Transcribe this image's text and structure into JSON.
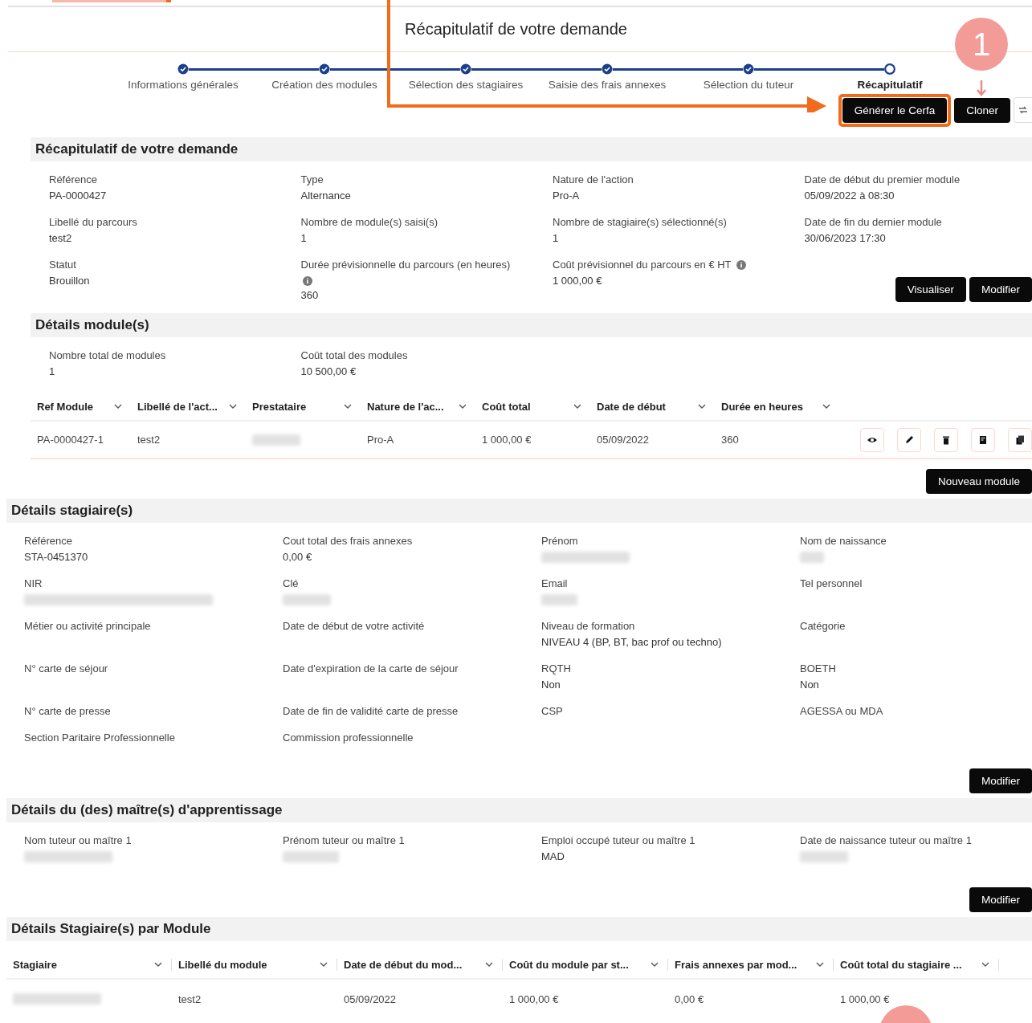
{
  "title": "Récapitulatif de votre demande",
  "steps": [
    {
      "label": "Informations générales",
      "done": true,
      "selected": false
    },
    {
      "label": "Création des modules",
      "done": true,
      "selected": false
    },
    {
      "label": "Sélection des stagiaires",
      "done": true,
      "selected": false
    },
    {
      "label": "Saisie des frais annexes",
      "done": true,
      "selected": false
    },
    {
      "label": "Sélection du tuteur",
      "done": true,
      "selected": false
    },
    {
      "label": "Récapitulatif",
      "done": false,
      "selected": true
    }
  ],
  "actions": [
    {
      "label": "Générer le Cerfa",
      "highlighted": true
    },
    {
      "label": "Cloner",
      "highlighted": false
    }
  ],
  "callout": {
    "number": "1"
  },
  "summary": {
    "title": "Récapitulatif de votre demande",
    "fields": [
      {
        "label": "Référence",
        "value": "PA-0000427"
      },
      {
        "label": "Type",
        "value": "Alternance"
      },
      {
        "label": "Nature de l'action",
        "value": "Pro-A"
      },
      {
        "label": "Date de début du premier module",
        "value": "05/09/2022 à 08:30"
      },
      {
        "label": "Libellé du parcours",
        "value": "test2"
      },
      {
        "label": "Nombre de module(s) saisi(s)",
        "value": "1"
      },
      {
        "label": "Nombre de stagiaire(s) sélectionné(s)",
        "value": "1"
      },
      {
        "label": "Date de fin du dernier module",
        "value": "30/06/2023 17:30"
      },
      {
        "label": "Statut",
        "value": "Brouillon"
      },
      {
        "label": "Durée prévisionnelle du parcours (en heures)",
        "value": "360",
        "info": true,
        "info_wraps": true
      },
      {
        "label": "Coût prévisionnel du parcours en € HT",
        "value": "1 000,00 €",
        "info": true,
        "info_wraps": false
      }
    ],
    "buttons": [
      "Visualiser",
      "Modifier"
    ]
  },
  "modules": {
    "title": "Détails module(s)",
    "fields": [
      {
        "label": "Nombre total de modules",
        "value": "1"
      },
      {
        "label": "Coût total des modules",
        "value": "10 500,00 €"
      }
    ],
    "table": {
      "columns": [
        "Ref Module",
        "Libellé de l'act...",
        "Prestataire",
        "Nature de l'ac...",
        "Coût total",
        "Date de début",
        "Durée en heures"
      ],
      "rows": [
        {
          "cells": [
            {
              "text": "PA-0000427-1"
            },
            {
              "text": "test2"
            },
            {
              "redacted": true
            },
            {
              "text": "Pro-A"
            },
            {
              "text": "1 000,00 €"
            },
            {
              "text": "05/09/2022"
            },
            {
              "text": "360"
            }
          ]
        }
      ]
    },
    "button": "Nouveau module"
  },
  "trainees": {
    "title": "Détails stagiaire(s)",
    "fields": [
      {
        "label": "Référence",
        "value": "STA-0451370"
      },
      {
        "label": "Cout total des frais annexes",
        "value": "0,00 €"
      },
      {
        "label": "Prénom",
        "redacted": true
      },
      {
        "label": "Nom de naissance",
        "redacted": true
      },
      {
        "label": "NIR",
        "redacted": true
      },
      {
        "label": "Clé",
        "redacted": true
      },
      {
        "label": "Email",
        "redacted": true
      },
      {
        "label": "Tel personnel"
      },
      {
        "label": "Métier ou activité principale"
      },
      {
        "label": "Date de début de votre activité"
      },
      {
        "label": "Niveau de formation",
        "value": "NIVEAU 4 (BP, BT, bac prof ou techno)"
      },
      {
        "label": "Catégorie"
      },
      {
        "label": "N° carte de séjour"
      },
      {
        "label": "Date d'expiration de la carte de séjour"
      },
      {
        "label": "RQTH",
        "value": "Non"
      },
      {
        "label": "BOETH",
        "value": "Non"
      },
      {
        "label": "N° carte de presse"
      },
      {
        "label": "Date de fin de validité carte de presse"
      },
      {
        "label": "CSP"
      },
      {
        "label": "AGESSA ou MDA"
      },
      {
        "label": "Section Paritaire Professionnelle"
      },
      {
        "label": "Commission professionnelle"
      }
    ],
    "button": "Modifier"
  },
  "tutors": {
    "title": "Détails du (des) maître(s) d'apprentissage",
    "fields": [
      {
        "label": "Nom tuteur ou maître 1",
        "redacted": true
      },
      {
        "label": "Prénom tuteur ou maître 1",
        "redacted": true
      },
      {
        "label": "Emploi occupé tuteur ou maître 1",
        "value": "MAD"
      },
      {
        "label": "Date de naissance tuteur ou maître 1",
        "redacted": true
      }
    ],
    "button": "Modifier"
  },
  "trainee_modules": {
    "title": "Détails Stagiaire(s) par Module",
    "table": {
      "columns": [
        "Stagiaire",
        "Libellé du module",
        "Date de début du mod...",
        "Coût du module par st...",
        "Frais annexes par mod...",
        "Coût total du stagiaire ..."
      ],
      "rows": [
        {
          "cells": [
            {
              "redacted": true
            },
            {
              "text": "test2"
            },
            {
              "text": "05/09/2022"
            },
            {
              "text": "1 000,00 €"
            },
            {
              "text": "0,00 €"
            },
            {
              "text": "1 000,00 €"
            }
          ]
        }
      ]
    }
  }
}
